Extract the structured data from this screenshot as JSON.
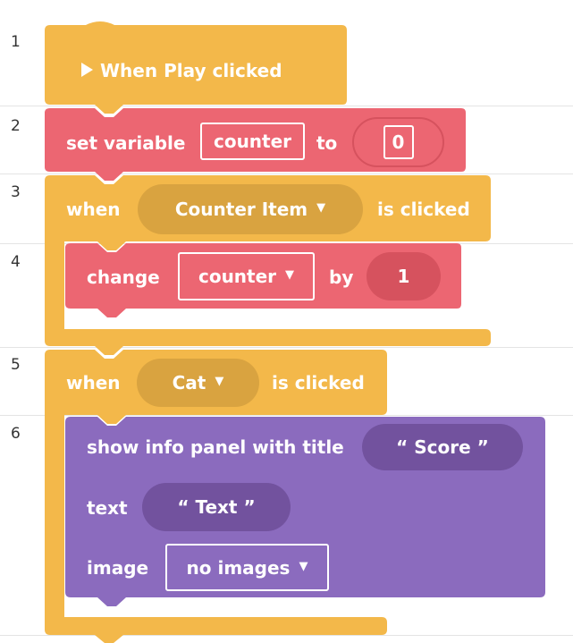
{
  "line_numbers": [
    "1",
    "2",
    "3",
    "4",
    "5",
    "6"
  ],
  "colors": {
    "events": "#F3B84A",
    "events_dark": "#D9A340",
    "variables": "#EC6672",
    "variables_dark": "#D6525E",
    "looks": "#8B6BBE",
    "looks_dark": "#72529E",
    "row_line": "#e4e4e4"
  },
  "blocks": {
    "when_play": {
      "icon": "play-triangle-icon",
      "label": "When Play clicked"
    },
    "set_variable": {
      "label": "set variable",
      "variable": "counter",
      "to_label": "to",
      "value": "0"
    },
    "when_counter_item": {
      "when_label": "when",
      "sprite": "Counter Item",
      "suffix": "is clicked"
    },
    "change_counter": {
      "label": "change",
      "variable": "counter",
      "by_label": "by",
      "value": "1"
    },
    "when_cat": {
      "when_label": "when",
      "sprite": "Cat",
      "suffix": "is clicked"
    },
    "show_info_panel": {
      "label": "show info panel with title",
      "title_value": "“ Score ”",
      "text_label": "text",
      "text_value": "“ Text ”",
      "image_label": "image",
      "image_value": "no images"
    }
  }
}
